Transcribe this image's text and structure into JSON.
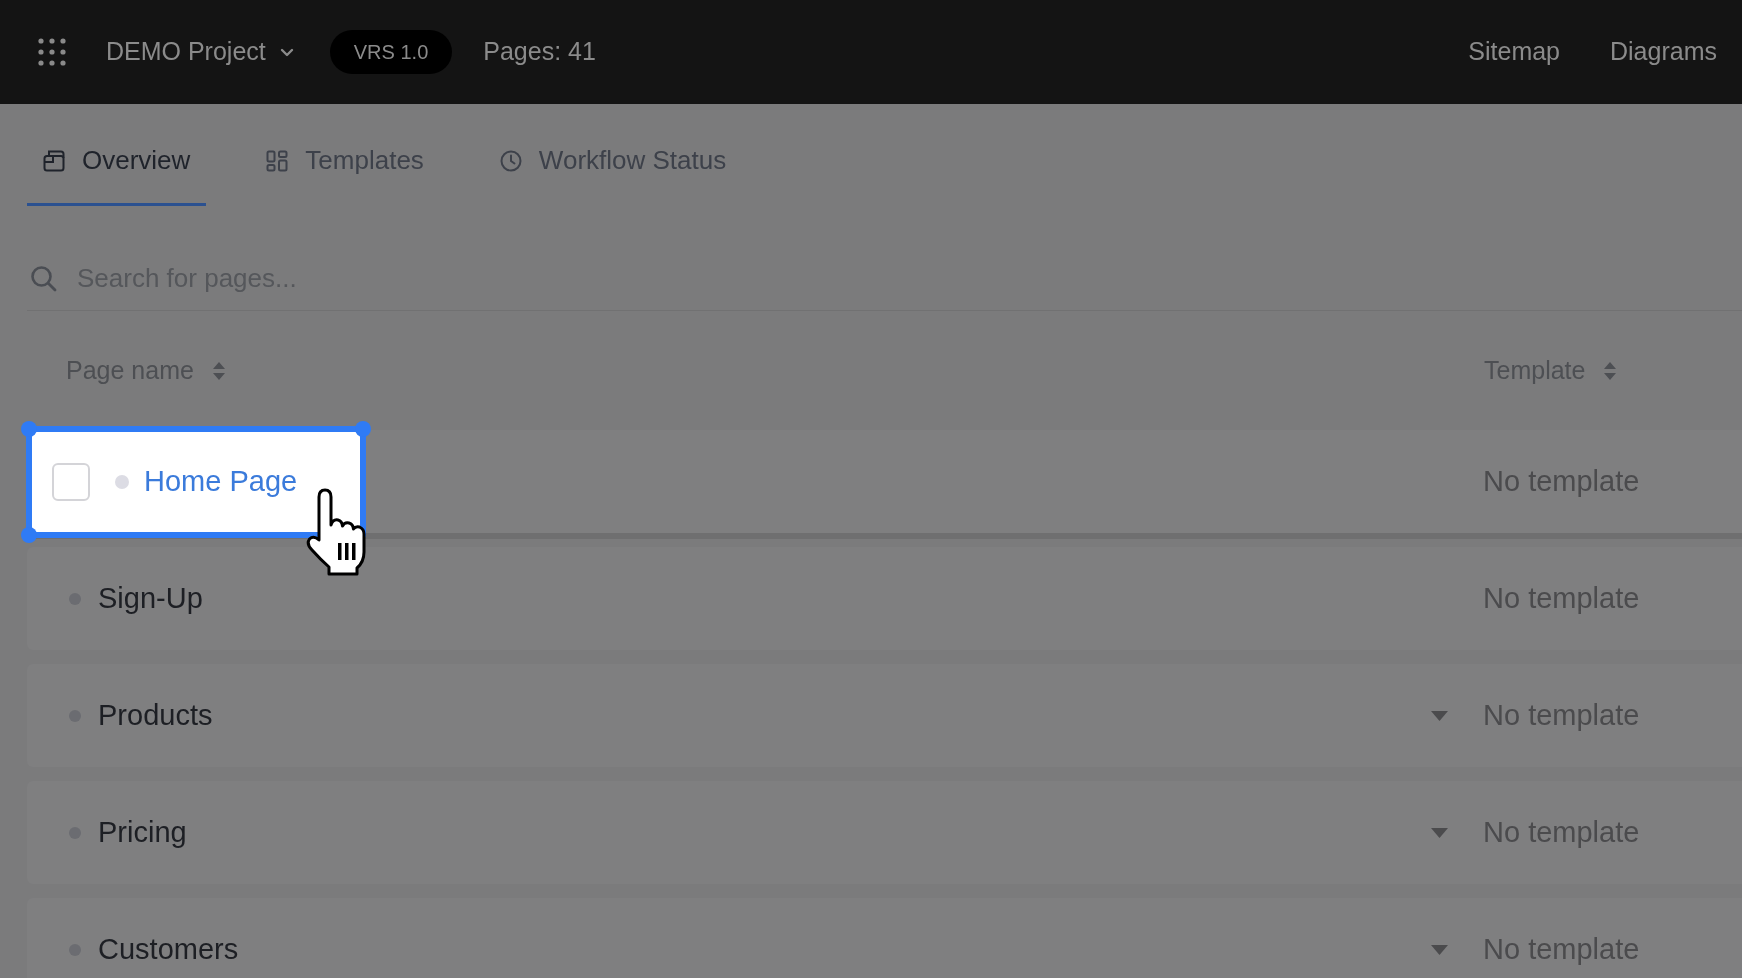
{
  "top_bar": {
    "project": "DEMO Project",
    "version_badge": "VRS 1.0",
    "page_count": "Pages: 41",
    "links": [
      "Sitemap",
      "Diagrams"
    ]
  },
  "tabs": [
    {
      "label": "Overview",
      "selected": true
    },
    {
      "label": "Templates",
      "selected": false
    },
    {
      "label": "Workflow Status",
      "selected": false
    }
  ],
  "search": {
    "placeholder": "Search for pages..."
  },
  "table": {
    "columns": [
      "Page name",
      "Template"
    ],
    "rows": [
      {
        "name": "Home Page",
        "template": "No template",
        "selected": true,
        "checked": false,
        "has_children": false
      },
      {
        "name": "Sign-Up",
        "template": "No template",
        "selected": false,
        "has_children": false
      },
      {
        "name": "Products",
        "template": "No template",
        "selected": false,
        "has_children": true
      },
      {
        "name": "Pricing",
        "template": "No template",
        "selected": false,
        "has_children": true
      },
      {
        "name": "Customers",
        "template": "No template",
        "selected": false,
        "has_children": true
      }
    ]
  }
}
